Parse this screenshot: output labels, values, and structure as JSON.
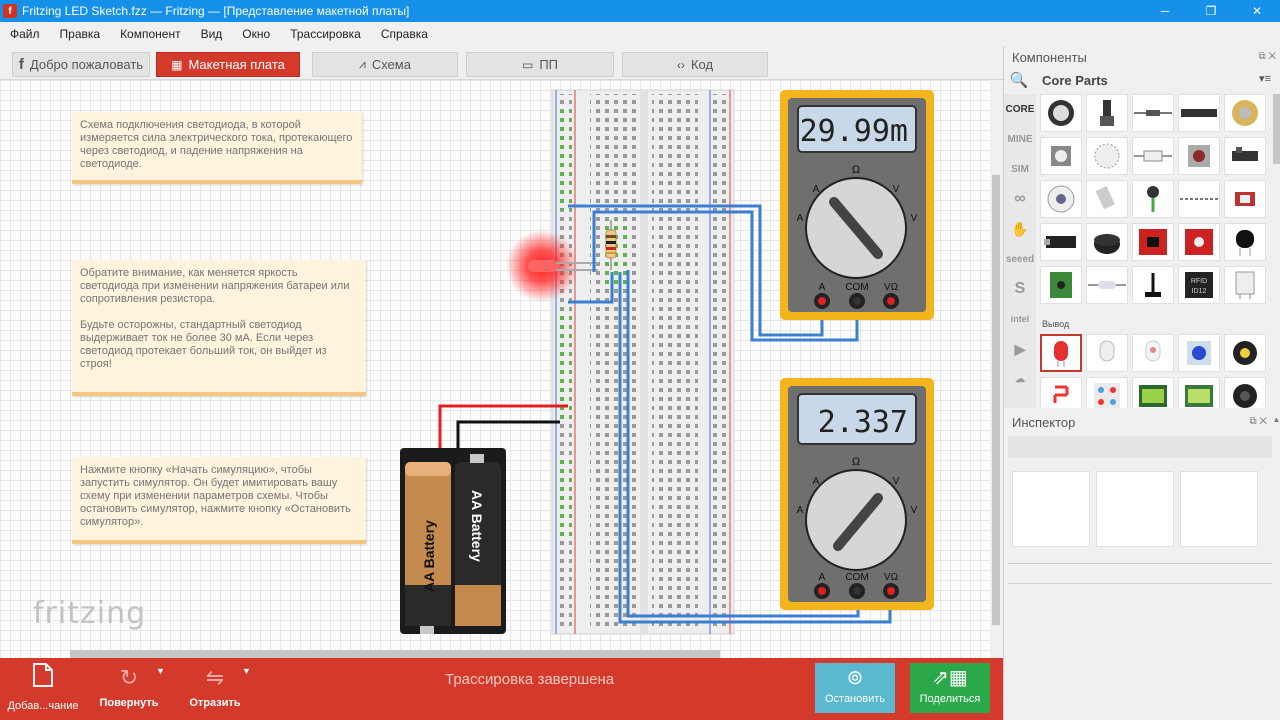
{
  "window": {
    "title": "Fritzing LED Sketch.fzz — Fritzing — [Представление макетной платы]",
    "app_icon": "f",
    "controls": {
      "minimize": "─",
      "maximize": "❐",
      "close": "✕"
    }
  },
  "menu": [
    "Файл",
    "Правка",
    "Компонент",
    "Вид",
    "Окно",
    "Трассировка",
    "Справка"
  ],
  "tabs": [
    {
      "label": "Добро пожаловать",
      "icon": "f-logo-icon",
      "glyph": "f"
    },
    {
      "label": "Макетная плата",
      "icon": "breadboard-icon",
      "glyph": "▦",
      "active": true
    },
    {
      "label": "Схема",
      "icon": "schematic-icon",
      "glyph": "⩘"
    },
    {
      "label": "ПП",
      "icon": "pcb-icon",
      "glyph": "▭"
    },
    {
      "label": "Код",
      "icon": "code-icon",
      "glyph": "‹›"
    }
  ],
  "notes": {
    "note1": "Схема подключения светодиода, в которой измеряется сила электрического тока, протекающего через светодиод, и падение напряжения на светодиоде.",
    "note2_p1": "Обратите внимание, как меняется яркость светодиода при изменении напряжения батареи или сопротивления резистора.",
    "note2_p2": "Будьте осторожны, стандартный светодиод выдерживает ток не более 30 мА. Если через светодиод протекает больший ток, он выйдет из строя!",
    "note3": "Нажмите кнопку «Начать симуляцию», чтобы запустить симулятор. Он будет имитировать вашу схему при изменении параметров схемы. Чтобы остановить симулятор, нажмите кнопку «Остановить симулятор»."
  },
  "watermark": "fritzing",
  "multimeter1": {
    "display": "29.99m",
    "dial_symbols": {
      "omega": "Ω",
      "a_left": "A",
      "a_left2": "A",
      "v_right": "V",
      "v_right2": "V"
    },
    "jacks": {
      "a": "A",
      "com": "COM",
      "v_ohm": "VΩ"
    }
  },
  "multimeter2": {
    "display": "2.337",
    "dial_symbols": {
      "omega": "Ω",
      "a_left": "A",
      "a_left2": "A",
      "v_right": "V",
      "v_right2": "V"
    },
    "jacks": {
      "a": "A",
      "com": "COM",
      "v_ohm": "VΩ"
    }
  },
  "battery": {
    "cell1_label": "AA Battery",
    "cell2_label": "AA Battery"
  },
  "toolbar": {
    "add_label": "Добав...чание",
    "rotate_label": "Повернуть",
    "flip_label": "Отразить",
    "routing_status": "Трассировка завершена",
    "stop_label": "Остановить",
    "share_label": "Поделиться"
  },
  "parts_panel": {
    "title": "Компоненты",
    "bin_title": "Core Parts",
    "bins": [
      "CORE",
      "MINE",
      "SIM",
      "∞",
      "✋",
      "seeed",
      "S",
      "intel",
      "▶",
      "☁"
    ],
    "section_label": "Вывод"
  },
  "inspector": {
    "title": "Инспектор"
  },
  "colors": {
    "accent_red": "#d33a2c",
    "titlebar_blue": "#1591ea",
    "wire_blue": "#3b7fd0",
    "wire_red": "#e02020",
    "multimeter_yellow": "#f2b51c",
    "stop_blue": "#5ab8cf",
    "share_green": "#2ba84a"
  }
}
